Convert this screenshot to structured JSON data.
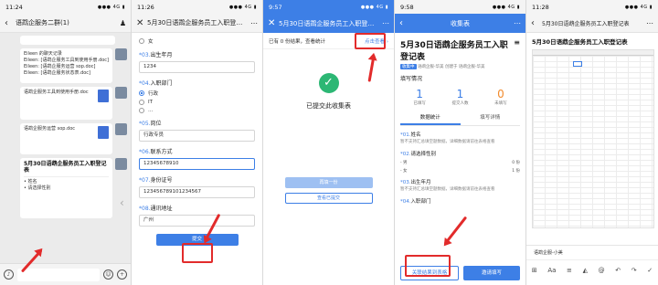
{
  "colors": {
    "accent": "#3d7fe6",
    "annotation": "#e22b2b",
    "success": "#2cb774",
    "warning": "#f28a2b"
  },
  "p1": {
    "time": "11:24",
    "indicators": "●●● 4G ▮",
    "title": "语鹉企服务二群(1)",
    "msgs": [
      {
        "text": "",
        "kind": "card"
      },
      {
        "text": "Eileen 的聊天记录\nEileen: [语鹉企服务工具到使用手册.doc]\nEileen: [语鹉企服务运营 sop.doc]\nEileen: [语鹉企服务状态表.doc]",
        "kind": "card"
      },
      {
        "text": "语鹉企服务工具到使用手册.doc",
        "kind": "doc"
      },
      {
        "text": "语鹉企服务运营 sop.doc",
        "kind": "doc"
      }
    ],
    "timestamp": "",
    "form_card_title": "5月30日语鹉企服务员工入职登记表",
    "form_card_sub": "",
    "form_card_items": [
      "姓名",
      "请选择性别"
    ],
    "emoji_icon": "☺",
    "plus_icon": "+"
  },
  "p2": {
    "time": "11:26",
    "title": "5月30日语鹉企服务员工入职登记表",
    "q3": {
      "no": "*03.",
      "label": "出生年月",
      "value": "1234"
    },
    "q4": {
      "no": "*04.",
      "label": "入职部门",
      "options": [
        "行政",
        "IT",
        "..."
      ]
    },
    "q5": {
      "no": "*05.",
      "label": "岗位",
      "value": "行政专员"
    },
    "q6": {
      "no": "*06.",
      "label": "联系方式",
      "value": "12345678910"
    },
    "q7": {
      "no": "*07.",
      "label": "身份证号",
      "value": "123456789101234567"
    },
    "q8": {
      "no": "*08.",
      "label": "通讯地址",
      "value": "广州"
    },
    "opt_female": "女",
    "submit": "提交"
  },
  "p3": {
    "time": "9:57",
    "title": "5月30日语鹉企服务员工入职登记表",
    "status": "已有 0 份结果，查看统计",
    "link": "点击查看 ›",
    "done": "已提交此收集表",
    "btn1": "再填一份",
    "btn2": "查看已提交"
  },
  "p4": {
    "time": "9:58",
    "nav_title": "收集表",
    "title": "5月30日语鹉企服务员工入职登记表",
    "tag": "收集中",
    "meta": "语鹉企服-华美 创建于 语鹉企服-华美",
    "section": "填写情况",
    "section_sub": "",
    "stats": [
      {
        "n": "1",
        "l": "已填写"
      },
      {
        "n": "1",
        "l": "提交人数"
      },
      {
        "n": "0",
        "l": "未填写"
      }
    ],
    "tab1": "数据统计",
    "tab2": "填写详情",
    "q1": {
      "no": "*01.",
      "label": "姓名"
    },
    "hint": "暂不支持汇总填空题数据，详细数据请前往表格查看",
    "q2": {
      "no": "*02.",
      "label": "请选择性别"
    },
    "q2_rows": [
      {
        "k": "- 男",
        "v": "0 份"
      },
      {
        "k": "- 女",
        "v": "1 份"
      }
    ],
    "q3": {
      "no": "*03.",
      "label": "出生年月"
    },
    "hint3": "暂不支持汇总填空题数据，详细数据请前往表格查看",
    "q4": {
      "no": "*04.",
      "label": "入职部门"
    },
    "btn_link": "关联结果到表格",
    "btn_invite": "邀请填写"
  },
  "p5": {
    "time": "11:28",
    "title": "5月30日语鹉企服务员工入职登记表",
    "row1": "",
    "row2": "",
    "sheet_tab": "语鹉企服-小美",
    "tools": [
      "⊞",
      "Aa",
      "≡",
      "◭",
      "@",
      "↶",
      "↷",
      "✓"
    ]
  }
}
